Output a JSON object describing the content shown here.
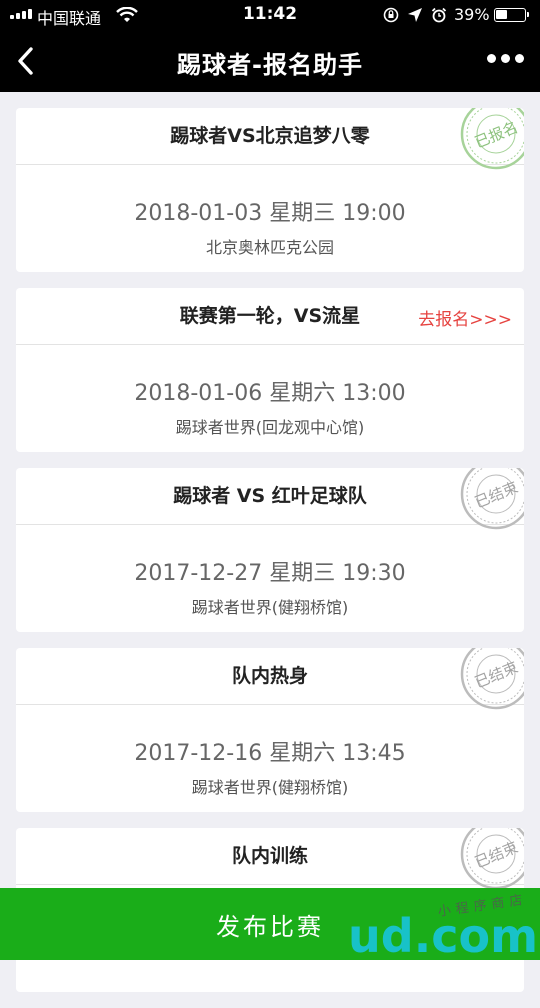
{
  "status_bar": {
    "carrier": "中国联通",
    "time": "11:42",
    "battery": "39%"
  },
  "nav": {
    "title": "踢球者-报名助手",
    "back_icon": "chevron-left-icon",
    "more_icon": "more-dots-icon"
  },
  "matches": [
    {
      "title": "踢球者VS北京追梦八零",
      "datetime": "2018-01-03 星期三 19:00",
      "venue": "北京奥林匹克公园",
      "stamp": "已报名"
    },
    {
      "title": "联赛第一轮，VS流星",
      "datetime": "2018-01-06 星期六 13:00",
      "venue": "踢球者世界(回龙观中心馆)",
      "action": "去报名>>>"
    },
    {
      "title": "踢球者 VS 红叶足球队",
      "datetime": "2017-12-27 星期三 19:30",
      "venue": "踢球者世界(健翔桥馆)",
      "stamp": "已结束"
    },
    {
      "title": "队内热身",
      "datetime": "2017-12-16 星期六 13:45",
      "venue": "踢球者世界(健翔桥馆)",
      "stamp": "已结束"
    },
    {
      "title": "队内训练",
      "stamp": "已结束"
    }
  ],
  "bottom_button": {
    "label": "发布比赛"
  },
  "watermark": {
    "main": "Qlud.com",
    "sub": "小程序商店"
  },
  "colors": {
    "nav_bg": "#000000",
    "page_bg": "#efeff4",
    "button_green": "#1aad19",
    "action_red": "#e64340",
    "stamp_green": "#8dc27e",
    "stamp_gray": "#a3a3a3"
  }
}
